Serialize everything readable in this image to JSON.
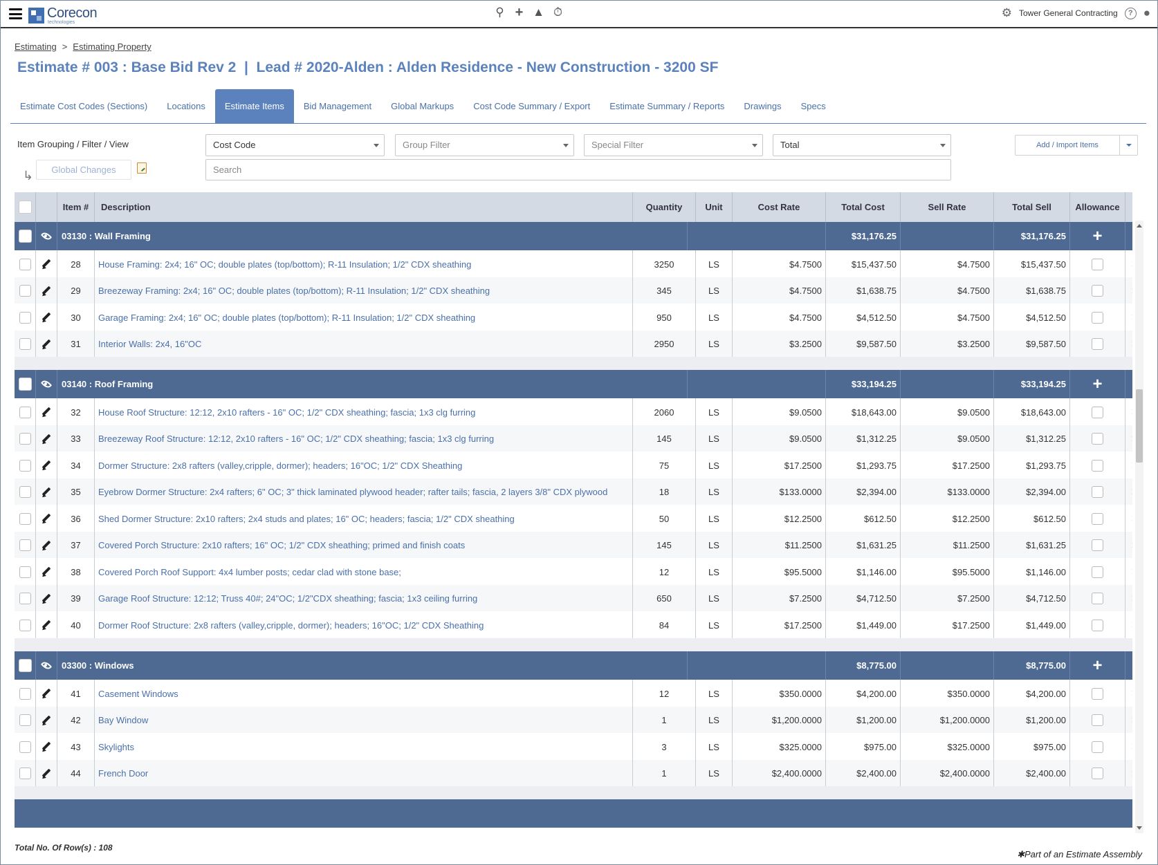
{
  "brand": {
    "name": "Corecon",
    "sub": "technologies"
  },
  "company": "Tower General Contracting",
  "breadcrumb": {
    "root": "Estimating",
    "sep": ">",
    "current": "Estimating Property"
  },
  "title": "Estimate # 003 : Base Bid Rev 2  |  Lead # 2020-Alden : Alden Residence - New Construction - 3200 SF",
  "tabs": [
    "Estimate Cost Codes (Sections)",
    "Locations",
    "Estimate Items",
    "Bid Management",
    "Global Markups",
    "Cost Code Summary / Export",
    "Estimate Summary / Reports",
    "Drawings",
    "Specs"
  ],
  "active_tab": "Estimate Items",
  "filters": {
    "label": "Item Grouping / Filter / View",
    "grouping": "Cost Code",
    "group_filter": "Group Filter",
    "special_filter": "Special Filter",
    "view": "Total",
    "search_placeholder": "Search",
    "add_import": "Add / Import Items",
    "global_changes": "Global Changes"
  },
  "columns": {
    "item": "Item #",
    "description": "Description",
    "quantity": "Quantity",
    "unit": "Unit",
    "cost_rate": "Cost Rate",
    "total_cost": "Total Cost",
    "sell_rate": "Sell Rate",
    "total_sell": "Total Sell",
    "allowance": "Allowance"
  },
  "groups": [
    {
      "title": "03130 : Wall Framing",
      "total_cost": "$31,176.25",
      "total_sell": "$31,176.25",
      "items": [
        [
          "28",
          "House Framing: 2x4; 16\" OC; double plates (top/bottom); R-11 Insulation; 1/2\" CDX sheathing",
          "3250",
          "LS",
          "$4.7500",
          "$15,437.50",
          "$4.7500",
          "$15,437.50"
        ],
        [
          "29",
          "Breezeway Framing: 2x4; 16\" OC; double plates (top/bottom); R-11 Insulation; 1/2\" CDX sheathing",
          "345",
          "LS",
          "$4.7500",
          "$1,638.75",
          "$4.7500",
          "$1,638.75"
        ],
        [
          "30",
          "Garage Framing: 2x4; 16\" OC; double plates (top/bottom); R-11 Insulation; 1/2\" CDX sheathing",
          "950",
          "LS",
          "$4.7500",
          "$4,512.50",
          "$4.7500",
          "$4,512.50"
        ],
        [
          "31",
          "Interior Walls: 2x4, 16\"OC",
          "2950",
          "LS",
          "$3.2500",
          "$9,587.50",
          "$3.2500",
          "$9,587.50"
        ]
      ]
    },
    {
      "title": "03140 : Roof Framing",
      "total_cost": "$33,194.25",
      "total_sell": "$33,194.25",
      "items": [
        [
          "32",
          "House Roof Structure: 12:12, 2x10 rafters - 16\" OC; 1/2\" CDX sheathing; fascia; 1x3 clg furring",
          "2060",
          "LS",
          "$9.0500",
          "$18,643.00",
          "$9.0500",
          "$18,643.00"
        ],
        [
          "33",
          "Breezeway Roof Structure: 12:12, 2x10 rafters - 16\" OC; 1/2\" CDX sheathing; fascia; 1x3 clg furring",
          "145",
          "LS",
          "$9.0500",
          "$1,312.25",
          "$9.0500",
          "$1,312.25"
        ],
        [
          "34",
          "Dormer Structure: 2x8 rafters (valley,cripple, dormer); headers; 16\"OC; 1/2\" CDX Sheathing",
          "75",
          "LS",
          "$17.2500",
          "$1,293.75",
          "$17.2500",
          "$1,293.75"
        ],
        [
          "35",
          "Eyebrow Dormer Structure: 2x4 rafters; 6\" OC; 3\" thick laminated plywood header; rafter tails; fascia, 2 layers 3/8\" CDX plywood",
          "18",
          "LS",
          "$133.0000",
          "$2,394.00",
          "$133.0000",
          "$2,394.00"
        ],
        [
          "36",
          "Shed Dormer Structure: 2x10 rafters; 2x4 studs and plates; 16\" OC; headers; fascia; 1/2\" CDX sheathing",
          "50",
          "LS",
          "$12.2500",
          "$612.50",
          "$12.2500",
          "$612.50"
        ],
        [
          "37",
          "Covered Porch Structure: 2x10 rafters; 16\" OC; 1/2\" CDX sheathing; primed and finish coats",
          "145",
          "LS",
          "$11.2500",
          "$1,631.25",
          "$11.2500",
          "$1,631.25"
        ],
        [
          "38",
          "Covered Porch Roof Support: 4x4 lumber posts; cedar clad with stone base;",
          "12",
          "LS",
          "$95.5000",
          "$1,146.00",
          "$95.5000",
          "$1,146.00"
        ],
        [
          "39",
          "Garage Roof Structure: 12:12; Truss 40#; 24\"OC; 1/2\"CDX sheathing; fascia; 1x3 ceiling furring",
          "650",
          "LS",
          "$7.2500",
          "$4,712.50",
          "$7.2500",
          "$4,712.50"
        ],
        [
          "40",
          "Dormer Roof Structure: 2x8 rafters (valley,cripple, dormer); headers; 16\"OC; 1/2\" CDX Sheathing",
          "84",
          "LS",
          "$17.2500",
          "$1,449.00",
          "$17.2500",
          "$1,449.00"
        ]
      ]
    },
    {
      "title": "03300 : Windows",
      "total_cost": "$8,775.00",
      "total_sell": "$8,775.00",
      "items": [
        [
          "41",
          "Casement Windows",
          "12",
          "LS",
          "$350.0000",
          "$4,200.00",
          "$350.0000",
          "$4,200.00"
        ],
        [
          "42",
          "Bay Window",
          "1",
          "LS",
          "$1,200.0000",
          "$1,200.00",
          "$1,200.0000",
          "$1,200.00"
        ],
        [
          "43",
          "Skylights",
          "3",
          "LS",
          "$325.0000",
          "$975.00",
          "$325.0000",
          "$975.00"
        ],
        [
          "44",
          "French Door",
          "1",
          "LS",
          "$2,400.0000",
          "$2,400.00",
          "$2,400.0000",
          "$2,400.00"
        ]
      ]
    }
  ],
  "footer": {
    "total_rows": "Total No. Of Row(s) : 108",
    "legend": "Part of an Estimate Assembly",
    "legend_mark": "✱"
  },
  "icons": [
    "menu-icon",
    "search-icon",
    "plus-icon",
    "bell-icon",
    "timer-icon",
    "gear-icon",
    "help-icon",
    "user-icon",
    "eye-icon",
    "pencil-icon",
    "delete-icon",
    "notepad-icon",
    "down-arrow-icon"
  ]
}
